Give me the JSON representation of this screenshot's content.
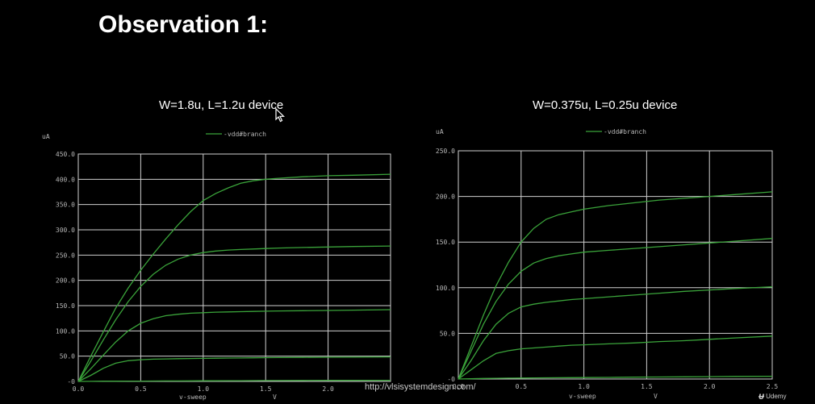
{
  "slide": {
    "title": "Observation 1:",
    "url": "http://vlsisystemdesign.com/",
    "logo_text": "Udemy"
  },
  "colors": {
    "background": "#000000",
    "grid": "#cfcfcf",
    "curve": "#3aa33a",
    "text": "#ffffff",
    "axis_text": "#b8b8b8"
  },
  "chart_data": [
    {
      "type": "line",
      "title": "W=1.8u, L=1.2u device",
      "ylabel": "uA",
      "xlabel": "v-sweep",
      "xunit": "V",
      "legend": "-vdd#branch",
      "legend_position": "top-center",
      "grid": true,
      "xlim": [
        0,
        2.5
      ],
      "ylim": [
        0,
        450
      ],
      "xticks": [
        "0.0",
        "0.5",
        "1.0",
        "1.5",
        "2.0"
      ],
      "yticks": [
        "-0",
        "50.0",
        "100.0",
        "150.0",
        "200.0",
        "250.0",
        "300.0",
        "350.0",
        "400.0",
        "450.0"
      ],
      "x": [
        0,
        0.1,
        0.2,
        0.3,
        0.4,
        0.5,
        0.6,
        0.7,
        0.8,
        0.9,
        1.0,
        1.1,
        1.2,
        1.3,
        1.4,
        1.5,
        1.6,
        1.8,
        2.0,
        2.2,
        2.5
      ],
      "series": [
        {
          "values": [
            0,
            50,
            98,
            145,
            185,
            220,
            252,
            282,
            310,
            336,
            358,
            372,
            383,
            392,
            397,
            400,
            402,
            405,
            407,
            408,
            410
          ]
        },
        {
          "values": [
            0,
            40,
            82,
            122,
            158,
            188,
            212,
            230,
            242,
            250,
            255,
            258,
            260,
            261,
            262,
            263,
            264,
            265,
            266,
            267,
            268
          ]
        },
        {
          "values": [
            0,
            25,
            52,
            78,
            100,
            115,
            124,
            130,
            133,
            135,
            136,
            137,
            137.5,
            138,
            138.5,
            139,
            139.5,
            140,
            140.5,
            141,
            142
          ]
        },
        {
          "values": [
            0,
            12,
            26,
            36,
            41,
            43,
            44,
            44.5,
            45,
            45.3,
            45.6,
            46,
            46.2,
            46.5,
            46.7,
            47,
            47.2,
            47.5,
            47.8,
            48,
            48.5
          ]
        },
        {
          "values": [
            0,
            0.2,
            0.4,
            0.5,
            0.6,
            0.7,
            0.8,
            0.9,
            1,
            1.1,
            1.2,
            1.3,
            1.4,
            1.5,
            1.6,
            1.7,
            1.8,
            1.9,
            2,
            2.1,
            2.2
          ]
        }
      ]
    },
    {
      "type": "line",
      "title": "W=0.375u, L=0.25u device",
      "ylabel": "uA",
      "xlabel": "v-sweep",
      "xunit": "V",
      "legend": "-vdd#branch",
      "legend_position": "top-center",
      "grid": true,
      "xlim": [
        0,
        2.5
      ],
      "ylim": [
        0,
        250
      ],
      "xticks": [
        "0.0",
        "0.5",
        "1.0",
        "1.5",
        "2.0",
        "2.5"
      ],
      "yticks": [
        "-0",
        "50.0",
        "100.0",
        "150.0",
        "200.0",
        "250.0"
      ],
      "x": [
        0,
        0.1,
        0.2,
        0.3,
        0.4,
        0.5,
        0.6,
        0.7,
        0.8,
        0.9,
        1.0,
        1.2,
        1.4,
        1.6,
        1.8,
        2.0,
        2.2,
        2.5
      ],
      "series": [
        {
          "values": [
            0,
            35,
            70,
            102,
            128,
            150,
            165,
            175,
            180,
            183,
            186,
            190,
            193,
            196,
            198,
            200,
            202,
            205
          ]
        },
        {
          "values": [
            0,
            30,
            60,
            85,
            104,
            118,
            127,
            132,
            135,
            137,
            139,
            141,
            143,
            145,
            147,
            149,
            151,
            154
          ]
        },
        {
          "values": [
            0,
            20,
            42,
            60,
            72,
            79,
            82,
            84,
            85.5,
            87,
            88,
            90,
            92,
            94,
            96,
            97.5,
            99,
            101
          ]
        },
        {
          "values": [
            0,
            10,
            20,
            28,
            31,
            33,
            34,
            35,
            36,
            37,
            37.5,
            38.5,
            39.5,
            41,
            42,
            43.5,
            45,
            47
          ]
        },
        {
          "values": [
            0,
            0.3,
            0.6,
            0.8,
            1,
            1.1,
            1.2,
            1.3,
            1.4,
            1.5,
            1.6,
            1.8,
            2,
            2.2,
            2.4,
            2.6,
            2.8,
            3
          ]
        }
      ]
    }
  ]
}
